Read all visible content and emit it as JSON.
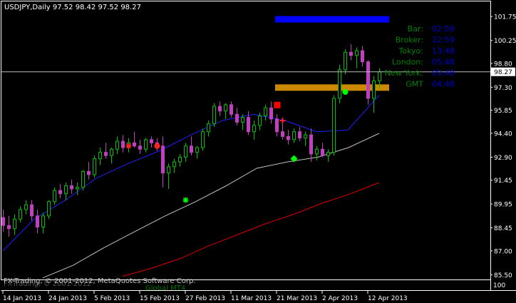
{
  "window": {
    "header": "USDJPY,Daily  97.52 98.42 97.52 98.27",
    "copyright": "FX-Trading, © 2001-2012, MetaQuotes Software Corp.",
    "copyright_back": "FXTrading, © 2001-2012",
    "watermark": "Global MT4"
  },
  "info_panel": [
    {
      "label": "Bar:",
      "value": "02:59"
    },
    {
      "label": "Broker:",
      "value": "22:59"
    },
    {
      "label": "Tokyo:",
      "value": "13:48"
    },
    {
      "label": "London:",
      "value": "05:48"
    },
    {
      "label": "New York:",
      "value": "00:48"
    },
    {
      "label": "GMT",
      "value": "04:48"
    }
  ],
  "colors": {
    "background": "#000000",
    "axis": "#ffffff",
    "bull": "#00c000",
    "bear": "#c040c0",
    "ma_fast": "#2020ff",
    "ma_mid": "#c0c0c0",
    "ma_slow": "#e00000",
    "bar_blue": "#0000ff",
    "bar_gold": "#cc8800",
    "info_label": "#008000",
    "info_value": "#0000cc"
  },
  "chart_data": {
    "type": "candlestick",
    "symbol": "USDJPY",
    "timeframe": "Daily",
    "ylim": [
      85.2,
      102.7
    ],
    "y_ticks": [
      "101.75",
      "100.25",
      "98.80",
      "97.30",
      "95.85",
      "94.40",
      "92.90",
      "91.45",
      "89.95",
      "88.45",
      "87.00",
      "85.50"
    ],
    "x_ticks": [
      {
        "label": "14 Jan 2013",
        "i": 0
      },
      {
        "label": "24 Jan 2013",
        "i": 8
      },
      {
        "label": "5 Feb 2013",
        "i": 16
      },
      {
        "label": "15 Feb 2013",
        "i": 24
      },
      {
        "label": "27 Feb 2013",
        "i": 32
      },
      {
        "label": "11 Mar 2013",
        "i": 40
      },
      {
        "label": "21 Mar 2013",
        "i": 48
      },
      {
        "label": "2 Apr 2013",
        "i": 56
      },
      {
        "label": "12 Apr 2013",
        "i": 64
      }
    ],
    "current_price": "98.27",
    "bottom_right_label": "100",
    "candles": [
      [
        89.1,
        89.6,
        88.2,
        88.6
      ],
      [
        88.6,
        89.2,
        87.9,
        88.4
      ],
      [
        88.4,
        89.3,
        88.0,
        89.0
      ],
      [
        89.0,
        89.8,
        88.8,
        89.6
      ],
      [
        89.6,
        90.2,
        89.3,
        89.9
      ],
      [
        89.9,
        90.2,
        88.9,
        89.2
      ],
      [
        89.2,
        89.6,
        88.1,
        88.5
      ],
      [
        88.5,
        89.4,
        88.1,
        89.2
      ],
      [
        89.2,
        90.2,
        89.0,
        90.1
      ],
      [
        90.1,
        91.0,
        89.9,
        90.8
      ],
      [
        90.8,
        91.2,
        90.3,
        90.6
      ],
      [
        90.6,
        91.3,
        90.2,
        91.1
      ],
      [
        91.1,
        91.5,
        90.6,
        90.9
      ],
      [
        90.9,
        91.3,
        90.5,
        91.0
      ],
      [
        91.0,
        92.1,
        90.8,
        92.0
      ],
      [
        92.0,
        92.6,
        91.5,
        91.8
      ],
      [
        91.8,
        93.0,
        91.6,
        92.8
      ],
      [
        92.8,
        93.5,
        92.4,
        93.2
      ],
      [
        93.2,
        93.8,
        92.8,
        93.0
      ],
      [
        93.0,
        93.5,
        92.5,
        93.4
      ],
      [
        93.4,
        94.2,
        93.1,
        93.9
      ],
      [
        93.9,
        94.3,
        93.2,
        93.5
      ],
      [
        93.5,
        94.1,
        93.2,
        93.8
      ],
      [
        93.8,
        94.5,
        93.5,
        93.6
      ],
      [
        93.6,
        94.0,
        93.1,
        93.4
      ],
      [
        93.4,
        94.1,
        93.2,
        94.0
      ],
      [
        94.0,
        94.2,
        93.5,
        93.8
      ],
      [
        93.8,
        94.1,
        93.3,
        93.6
      ],
      [
        93.6,
        94.2,
        91.0,
        91.9
      ],
      [
        91.9,
        92.5,
        90.9,
        92.3
      ],
      [
        92.3,
        92.8,
        91.9,
        92.6
      ],
      [
        92.6,
        93.1,
        92.3,
        92.9
      ],
      [
        92.9,
        93.8,
        92.6,
        93.6
      ],
      [
        93.6,
        94.2,
        93.0,
        93.2
      ],
      [
        93.2,
        93.6,
        92.8,
        93.5
      ],
      [
        93.5,
        94.7,
        93.3,
        94.5
      ],
      [
        94.5,
        95.2,
        94.2,
        95.0
      ],
      [
        95.0,
        96.3,
        94.8,
        96.1
      ],
      [
        96.1,
        96.4,
        95.5,
        95.8
      ],
      [
        95.8,
        96.3,
        95.3,
        96.2
      ],
      [
        96.2,
        96.4,
        95.4,
        95.6
      ],
      [
        95.6,
        96.0,
        94.9,
        95.1
      ],
      [
        95.1,
        95.6,
        94.6,
        95.4
      ],
      [
        95.4,
        95.8,
        94.3,
        94.5
      ],
      [
        94.5,
        95.2,
        94.0,
        94.9
      ],
      [
        94.9,
        95.7,
        94.6,
        95.5
      ],
      [
        95.5,
        96.2,
        95.2,
        96.0
      ],
      [
        96.0,
        96.4,
        95.0,
        95.3
      ],
      [
        95.3,
        95.6,
        94.2,
        94.5
      ],
      [
        94.5,
        95.0,
        94.0,
        94.2
      ],
      [
        94.2,
        94.6,
        93.7,
        94.0
      ],
      [
        94.0,
        94.7,
        93.8,
        94.5
      ],
      [
        94.5,
        94.8,
        93.9,
        94.1
      ],
      [
        94.1,
        94.5,
        93.6,
        94.3
      ],
      [
        94.3,
        94.7,
        92.6,
        93.1
      ],
      [
        93.1,
        93.6,
        92.7,
        93.4
      ],
      [
        93.4,
        93.8,
        92.9,
        93.0
      ],
      [
        93.0,
        93.4,
        92.6,
        93.2
      ],
      [
        93.2,
        96.8,
        93.0,
        96.6
      ],
      [
        96.6,
        98.7,
        96.3,
        98.4
      ],
      [
        98.4,
        99.7,
        98.1,
        99.5
      ],
      [
        99.5,
        100.0,
        99.0,
        99.3
      ],
      [
        99.3,
        99.8,
        98.5,
        99.6
      ],
      [
        99.6,
        99.9,
        98.6,
        98.9
      ],
      [
        98.9,
        99.0,
        96.2,
        96.6
      ],
      [
        96.6,
        98.0,
        95.7,
        97.7
      ],
      [
        97.7,
        98.5,
        97.2,
        98.27
      ]
    ],
    "moving_averages": [
      {
        "name": "MA fast",
        "color": "#2020ff",
        "values": [
          87.0,
          89.0,
          90.2,
          91.6,
          92.5,
          93.3,
          94.3,
          95.2,
          95.6,
          95.2,
          94.5,
          94.6,
          96.8
        ]
      },
      {
        "name": "MA mid",
        "color": "#c0c0c0",
        "values": [
          85.3,
          86.1,
          87.2,
          88.2,
          89.2,
          90.1,
          91.1,
          92.2,
          92.6,
          92.9,
          93.5,
          94.4
        ]
      },
      {
        "name": "MA slow",
        "color": "#e00000",
        "values": [
          85.4,
          85.9,
          86.5,
          87.3,
          88.0,
          88.7,
          89.3,
          90.0,
          90.6,
          91.3
        ]
      }
    ],
    "levels": [
      {
        "price": 101.6,
        "from": 48,
        "to": 68,
        "color": "#0000ff"
      },
      {
        "price": 97.3,
        "from": 48,
        "to": 68,
        "color": "#cc8800"
      }
    ],
    "markers": [
      {
        "i": 22,
        "price": 93.6,
        "shape": "asterisk",
        "color": "#ff2020"
      },
      {
        "i": 27,
        "price": 93.6,
        "shape": "dot",
        "color": "#ff2020"
      },
      {
        "i": 32,
        "price": 90.2,
        "shape": "asterisk",
        "color": "#00ff00"
      },
      {
        "i": 48,
        "price": 96.2,
        "shape": "square",
        "color": "#ff0000"
      },
      {
        "i": 49,
        "price": 95.2,
        "shape": "plus",
        "color": "#ff2020"
      },
      {
        "i": 51,
        "price": 92.8,
        "shape": "diamond",
        "color": "#00ff00"
      },
      {
        "i": 60,
        "price": 97.0,
        "shape": "dot",
        "color": "#00ff00"
      }
    ]
  }
}
